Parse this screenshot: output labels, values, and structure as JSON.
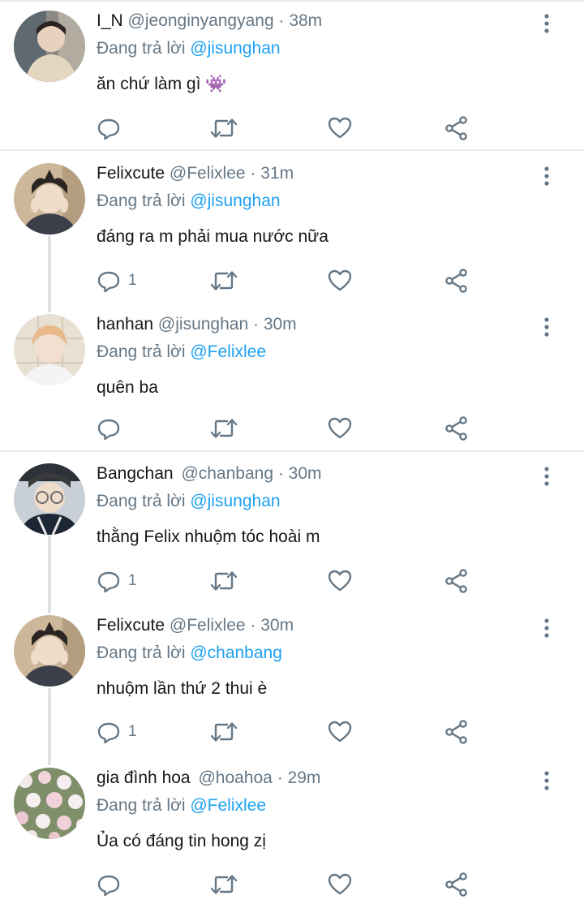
{
  "replying_label": "Đang trả lời",
  "colors": {
    "accent": "#1da1f2",
    "muted": "#657786",
    "text": "#14171a",
    "thread_line": "#dfe3e7"
  },
  "tweets": [
    {
      "name": "I_N",
      "handle": "@jeonginyangyang",
      "time": "· 38m",
      "replying_to": "@jisunghan",
      "text": "ăn chứ làm gì",
      "emoji": "👾",
      "reply_count": ""
    },
    {
      "name": "Felixcute",
      "handle": "@Felixlee",
      "time": "· 31m",
      "replying_to": "@jisunghan",
      "text": "đáng ra m phải mua nước nữa",
      "reply_count": "1"
    },
    {
      "name": "hanhan",
      "handle": "@jisunghan",
      "time": "· 30m",
      "replying_to": "@Felixlee",
      "text": "quên ba",
      "reply_count": ""
    },
    {
      "name": "Bangchan",
      "handle": "@chanbang",
      "time": "· 30m",
      "replying_to": "@jisunghan",
      "text": "thằng Felix nhuộm tóc hoài m",
      "reply_count": "1"
    },
    {
      "name": "Felixcute",
      "handle": "@Felixlee",
      "time": "· 30m",
      "replying_to": "@chanbang",
      "text": "nhuộm lần thứ 2 thui è",
      "reply_count": "1"
    },
    {
      "name": "gia đình hoa",
      "handle": "@hoahoa",
      "time": "· 29m",
      "replying_to": "@Felixlee",
      "text": "Ủa có đáng tin hong zị",
      "reply_count": ""
    }
  ],
  "icons": {
    "reply": "reply-icon",
    "retweet": "retweet-icon",
    "like": "heart-icon",
    "share": "share-icon",
    "more": "more-options-icon"
  }
}
